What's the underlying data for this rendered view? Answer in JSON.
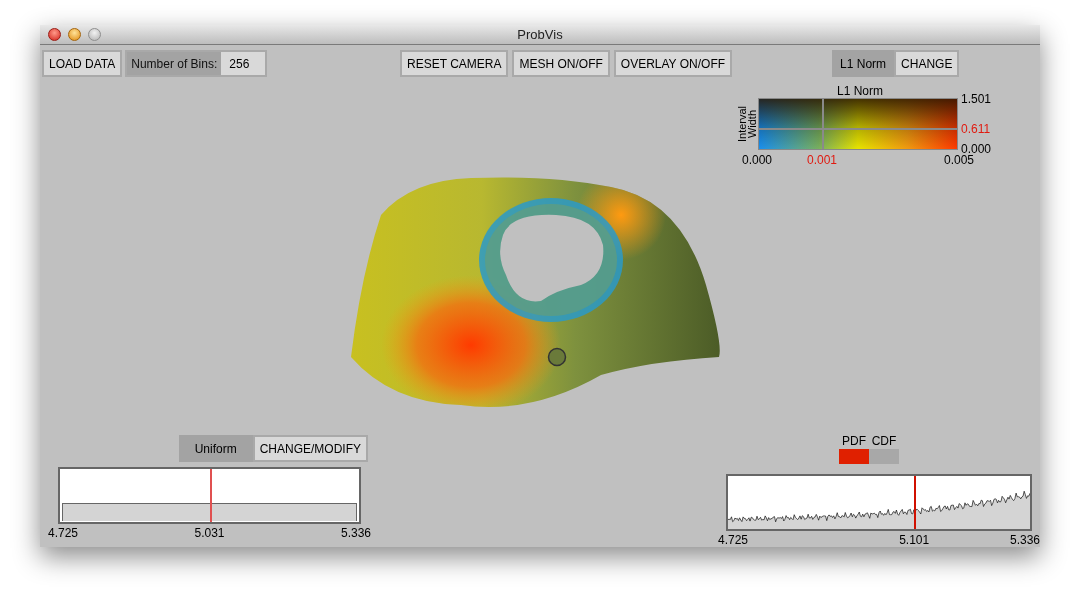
{
  "window": {
    "title": "ProbVis"
  },
  "toolbar": {
    "load_button": "LOAD DATA",
    "bins": {
      "label": "Number of Bins:",
      "value": "256"
    },
    "buttons": [
      "RESET CAMERA",
      "MESH ON/OFF",
      "OVERLAY ON/OFF"
    ]
  },
  "metric": {
    "label": "L1 Norm",
    "button": "CHANGE"
  },
  "colormap": {
    "title": "L1 Norm",
    "y_label": "Interval Width",
    "y_max": "1.501",
    "y_min": "0.000",
    "y_marker": {
      "label": "0.611"
    },
    "x_min": "0.000",
    "x_max": "0.005",
    "x_marker": {
      "label": "0.001",
      "level": 0.32
    }
  },
  "distribution": {
    "label": "Uniform",
    "button": "CHANGE/MODIFY",
    "marker": {
      "level": 0.5
    },
    "ticks": [
      "4.725",
      "5.031",
      "5.336"
    ]
  },
  "histogram": {
    "modes": [
      {
        "label": "PDF",
        "selected": true
      },
      {
        "label": "CDF",
        "selected": false
      }
    ],
    "marker": {
      "level": 0.615
    },
    "ticks": [
      "4.725",
      "5.101",
      "5.336"
    ]
  }
}
